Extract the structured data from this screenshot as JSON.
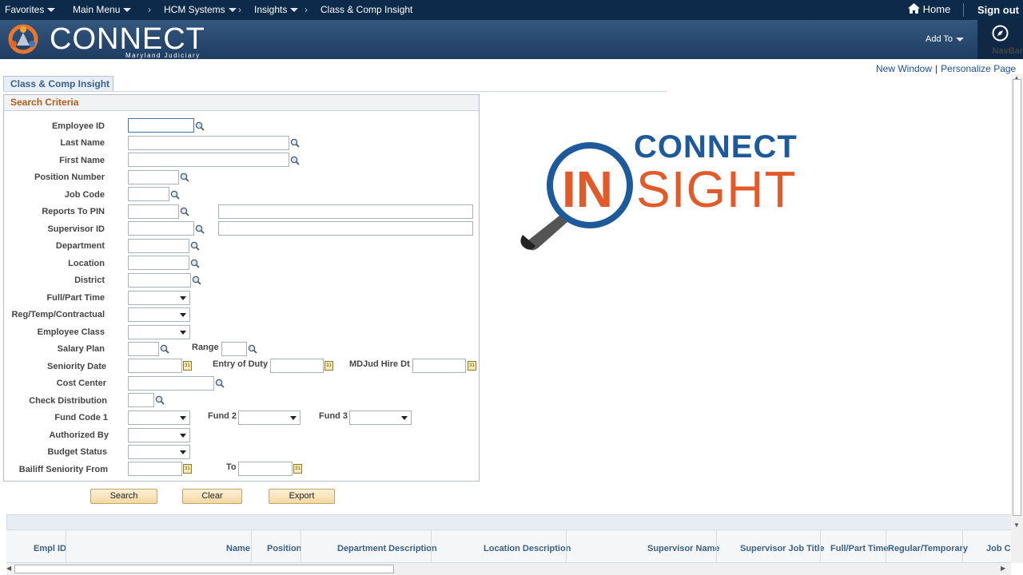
{
  "topnav": {
    "favorites": "Favorites",
    "main_menu": "Main Menu",
    "breadcrumb": [
      "HCM Systems",
      "Insights",
      "Class & Comp Insight"
    ],
    "home": "Home",
    "sign_out": "Sign out"
  },
  "banner": {
    "logo_word": "CONNECT",
    "logo_sub": "Maryland Judiciary",
    "add_to": "Add To",
    "navbar": "NavBar"
  },
  "links": {
    "new_window": "New Window",
    "personalize": "Personalize Page"
  },
  "tab": {
    "label": "Class & Comp Insight"
  },
  "panel": {
    "title": "Search Criteria",
    "fields": {
      "employee_id": "Employee ID",
      "last_name": "Last Name",
      "first_name": "First Name",
      "position_number": "Position Number",
      "job_code": "Job Code",
      "reports_to": "Reports To PIN",
      "supervisor_id": "Supervisor ID",
      "department": "Department",
      "location": "Location",
      "district": "District",
      "full_part": "Full/Part Time",
      "reg_temp": "Reg/Temp/Contractual",
      "employee_class": "Employee Class",
      "salary_plan": "Salary Plan",
      "range": "Range",
      "seniority_date": "Seniority Date",
      "entry_of_duty": "Entry of Duty",
      "mdjud_hire": "MDJud Hire Dt",
      "cost_center": "Cost Center",
      "check_distribution": "Check Distribution",
      "fund_code_1": "Fund Code 1",
      "fund_2": "Fund 2",
      "fund_3": "Fund 3",
      "authorized_by": "Authorized By",
      "budget_status": "Budget Status",
      "bailiff_seniority": "Bailiff Seniority From",
      "to": "To"
    }
  },
  "buttons": {
    "search": "Search",
    "clear": "Clear",
    "export": "Export"
  },
  "insight_logo": {
    "top": "CONNECT",
    "in": "IN",
    "sight": "SIGHT"
  },
  "grid": {
    "columns": [
      "Empl ID",
      "Name",
      "Position",
      "Department Description",
      "Location Description",
      "Supervisor Name",
      "Supervisor Job Title",
      "Full/Part Time",
      "Regular/Temporary",
      "Job C"
    ]
  },
  "colors": {
    "nav": "#0d2a4a",
    "banner": "#2a4d74",
    "accent_orange": "#e2592a",
    "accent_blue": "#1a4f9a"
  }
}
